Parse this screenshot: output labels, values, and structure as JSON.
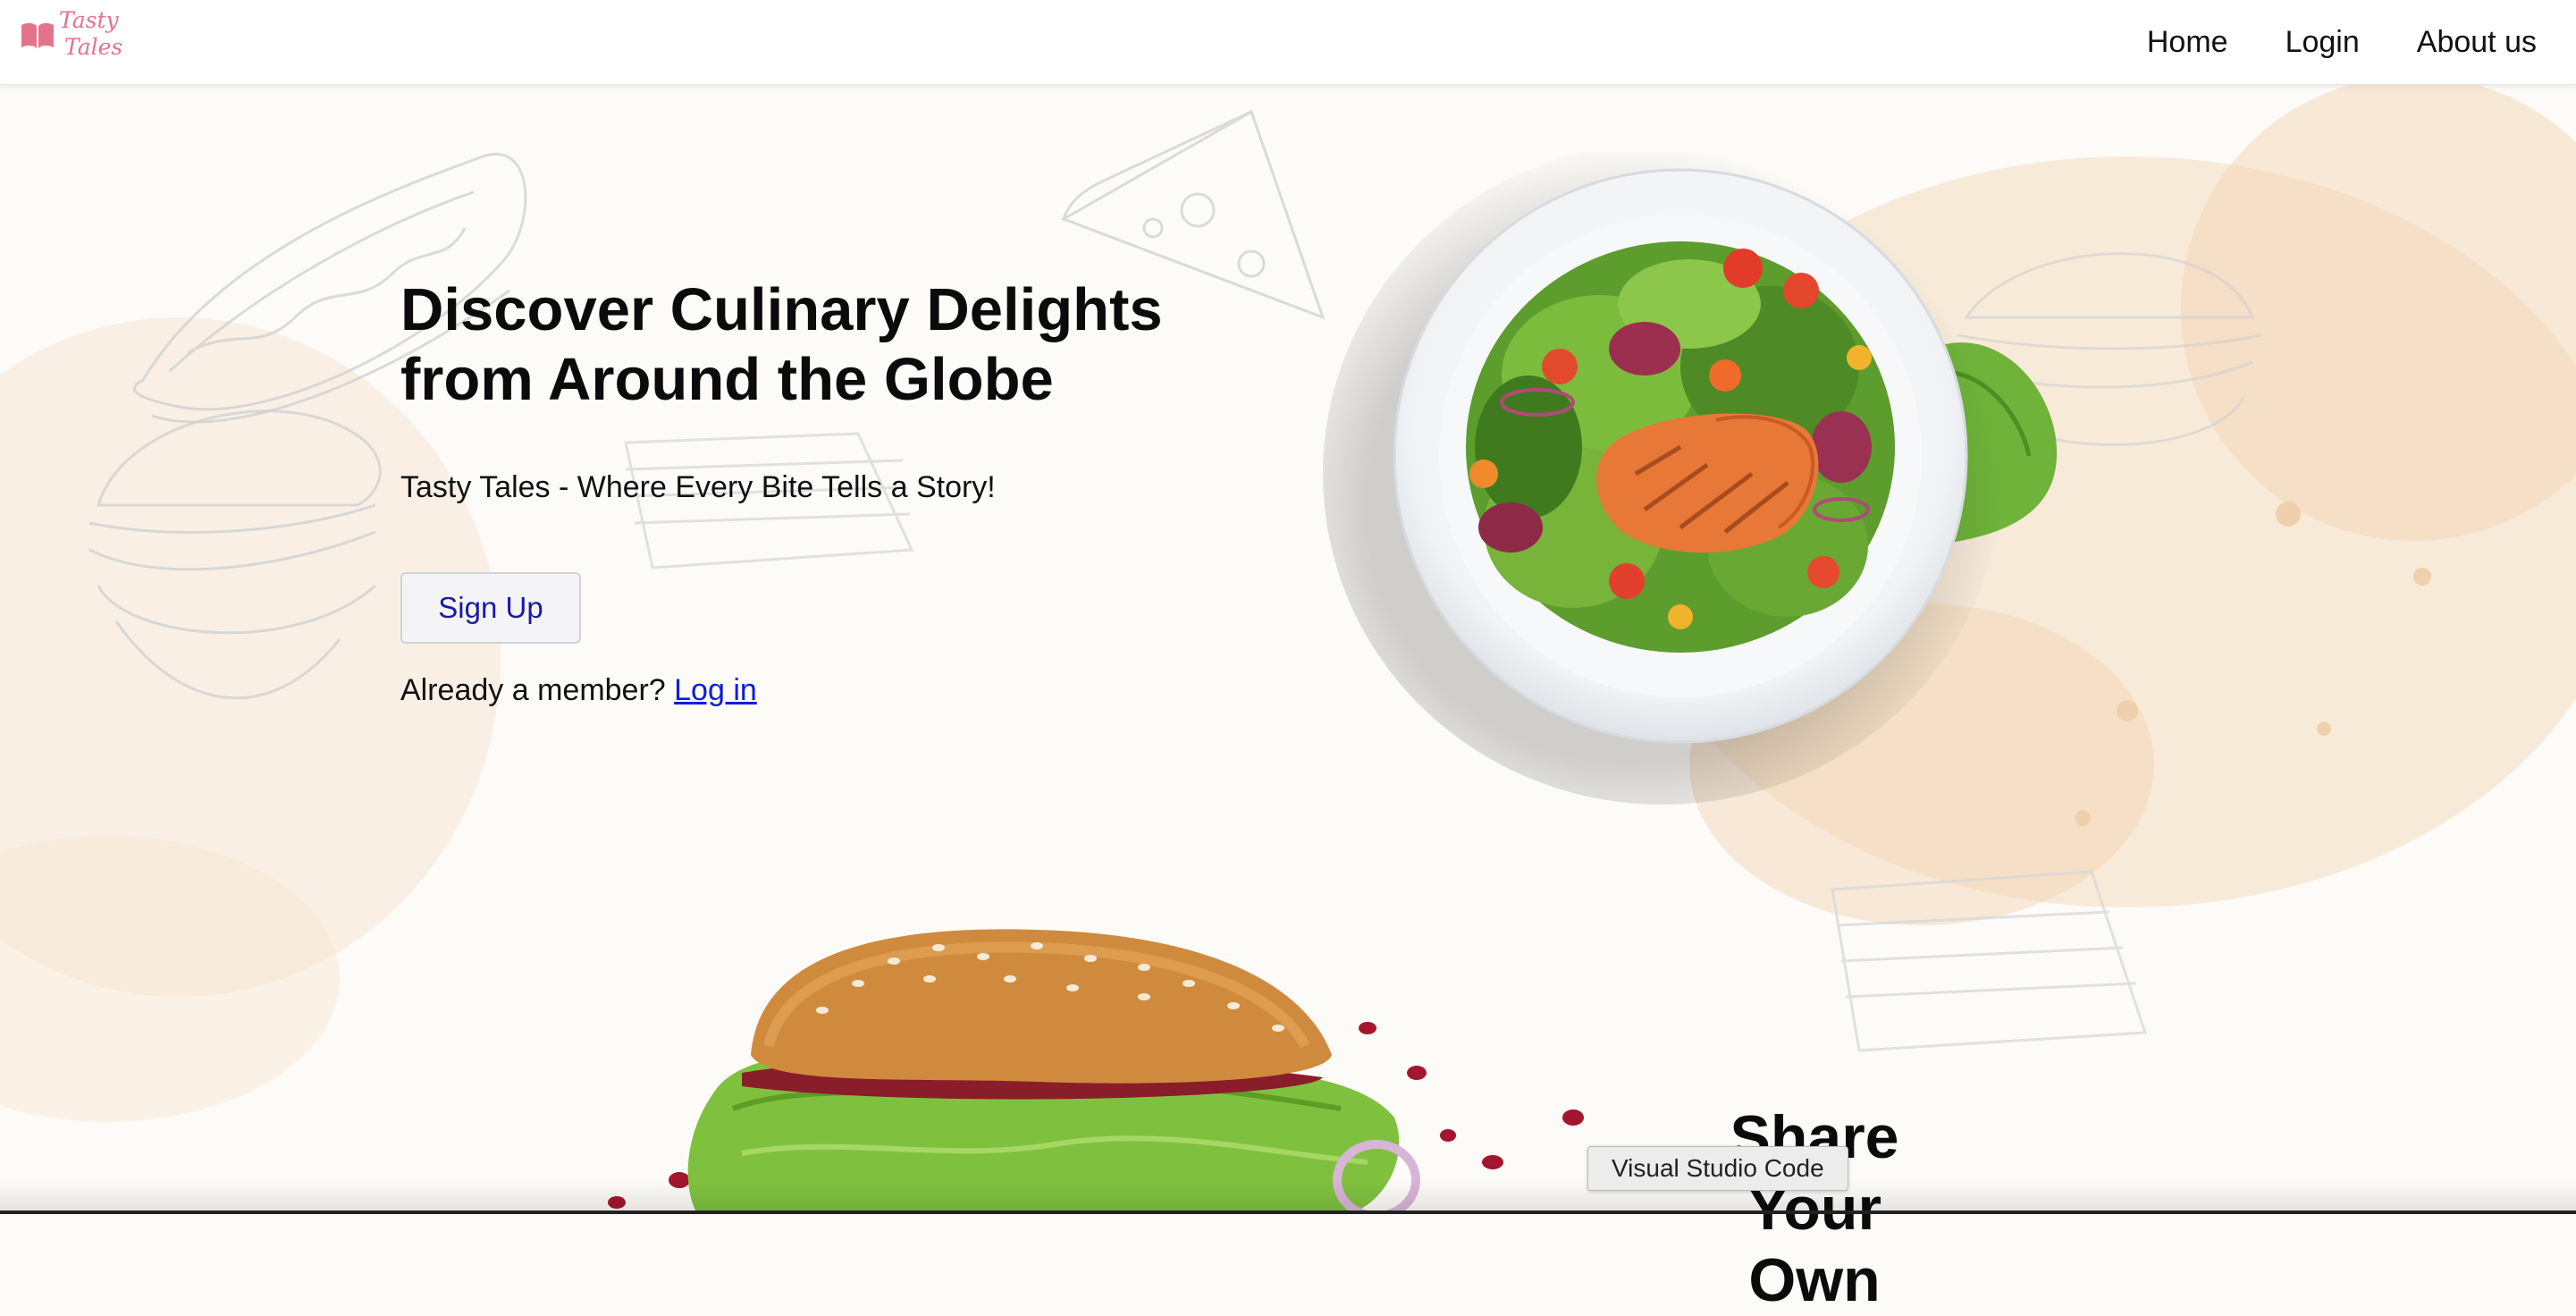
{
  "nav": {
    "logo_line1": "Tasty",
    "logo_line2": "Tales",
    "links": [
      "Home",
      "Login",
      "About us"
    ]
  },
  "hero": {
    "title_line1": "Discover Culinary Delights",
    "title_line2": "from Around the Globe",
    "tagline": "Tasty Tales - Where Every Bite Tells a Story!",
    "signup_label": "Sign Up",
    "member_text": "Already a member?",
    "login_link": "Log in"
  },
  "share": {
    "heading_line1": "Share",
    "heading_line2": "Your Own"
  },
  "tooltip": "Visual Studio Code",
  "colors": {
    "logo_pink": "#e5728b",
    "link_blue": "#0b1cd8",
    "button_text": "#1a1aa6",
    "background": "#fdfbf8",
    "splash": "#f4dcc0"
  }
}
